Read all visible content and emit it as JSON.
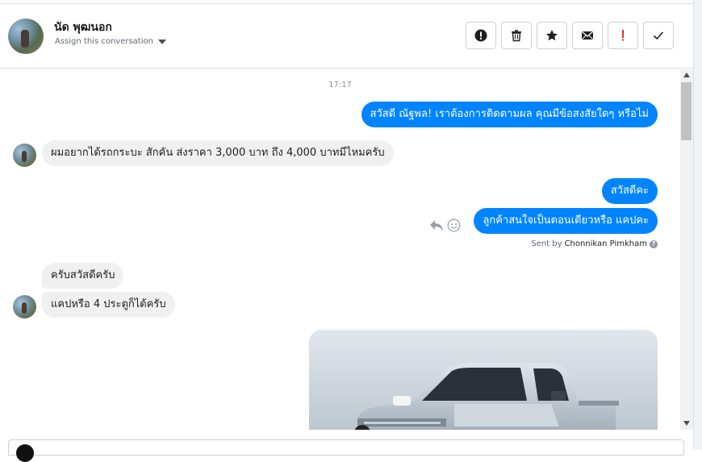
{
  "header": {
    "contact_name": "นัด พุฒนอก",
    "assign_label": "Assign this conversation",
    "actions": [
      {
        "icon": "alert-circle-icon"
      },
      {
        "icon": "trash-icon"
      },
      {
        "icon": "star-icon"
      },
      {
        "icon": "envelope-icon"
      },
      {
        "icon": "exclamation-icon",
        "color": "#d63031"
      },
      {
        "icon": "checkmark-icon"
      }
    ]
  },
  "thread": {
    "timestamp": "17:17",
    "messages": [
      {
        "direction": "out",
        "text": "สวัสดี ณัฐพล! เราต้องการติดตามผล คุณมีข้อสงสัยใดๆ หรือไม่"
      },
      {
        "direction": "in",
        "text": "ผมอยากได้รถกระบะ สักคัน ส่งราคา 3,000 บาท ถึง 4,000 บาทมีไหมครับ"
      },
      {
        "direction": "out",
        "text": "สวัสดีคะ"
      },
      {
        "direction": "out",
        "text": "ลูกค้าสนใจเป็นตอนเดียวหรือ แคปคะ"
      },
      {
        "direction": "in",
        "text": "ครับสวัสดีครับ"
      },
      {
        "direction": "in",
        "text": "แคปหรือ 4 ประตูก็ได้ครับ"
      }
    ],
    "sent_by_prefix": "Sent by",
    "sent_by_name": "Chonnikan Pimkham",
    "help_glyph": "?"
  },
  "colors": {
    "outgoing_bubble": "#0084ff",
    "incoming_bubble": "#f1f0f0",
    "alert_red": "#d63031"
  }
}
